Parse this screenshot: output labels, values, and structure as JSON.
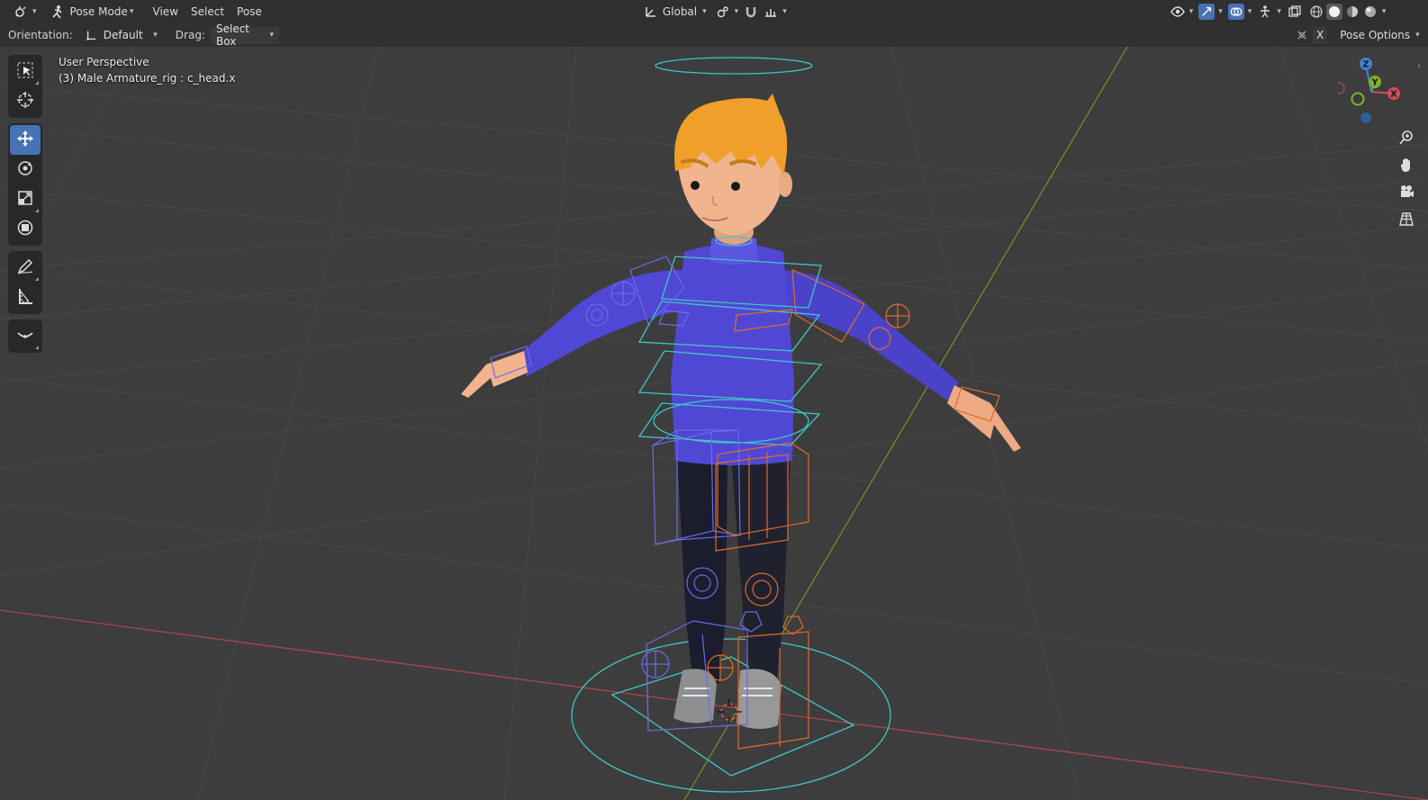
{
  "header": {
    "editor_type_icon": "editor-type-icon",
    "mode": "Pose Mode",
    "menus": [
      "View",
      "Select",
      "Pose"
    ],
    "transform_orientation": "Global",
    "pose_options": "Pose Options",
    "xray_label": "X"
  },
  "tool_settings": {
    "orientation_label": "Orientation:",
    "orientation_value": "Default",
    "drag_label": "Drag:",
    "drag_value": "Select Box"
  },
  "viewport": {
    "view_name": "User Perspective",
    "object_info": "(3) Male Armature_rig : c_head.x"
  },
  "tools": [
    {
      "name": "select-box",
      "icon": "cursor-select-icon"
    },
    {
      "name": "cursor",
      "icon": "3d-cursor-icon"
    },
    {
      "name": "move",
      "icon": "move-icon",
      "active": true
    },
    {
      "name": "rotate",
      "icon": "rotate-icon"
    },
    {
      "name": "scale",
      "icon": "scale-icon"
    },
    {
      "name": "transform",
      "icon": "transform-icon"
    },
    {
      "name": "annotate",
      "icon": "annotate-pencil-icon"
    },
    {
      "name": "measure",
      "icon": "measure-ruler-icon"
    },
    {
      "name": "relax-pose",
      "icon": "relax-curve-icon"
    }
  ],
  "gizmo": {
    "axes": [
      "X",
      "Y",
      "Z"
    ]
  },
  "colors": {
    "accent": "#4772b3",
    "x_axis": "#d24c5a",
    "y_axis": "#7db32b",
    "z_axis": "#3f83d6",
    "bone_cyan": "#3fc6c6",
    "bone_left": "#6a6ae8",
    "bone_right": "#e06a2c",
    "sweater": "#5048d4",
    "hair": "#f0a02a"
  }
}
